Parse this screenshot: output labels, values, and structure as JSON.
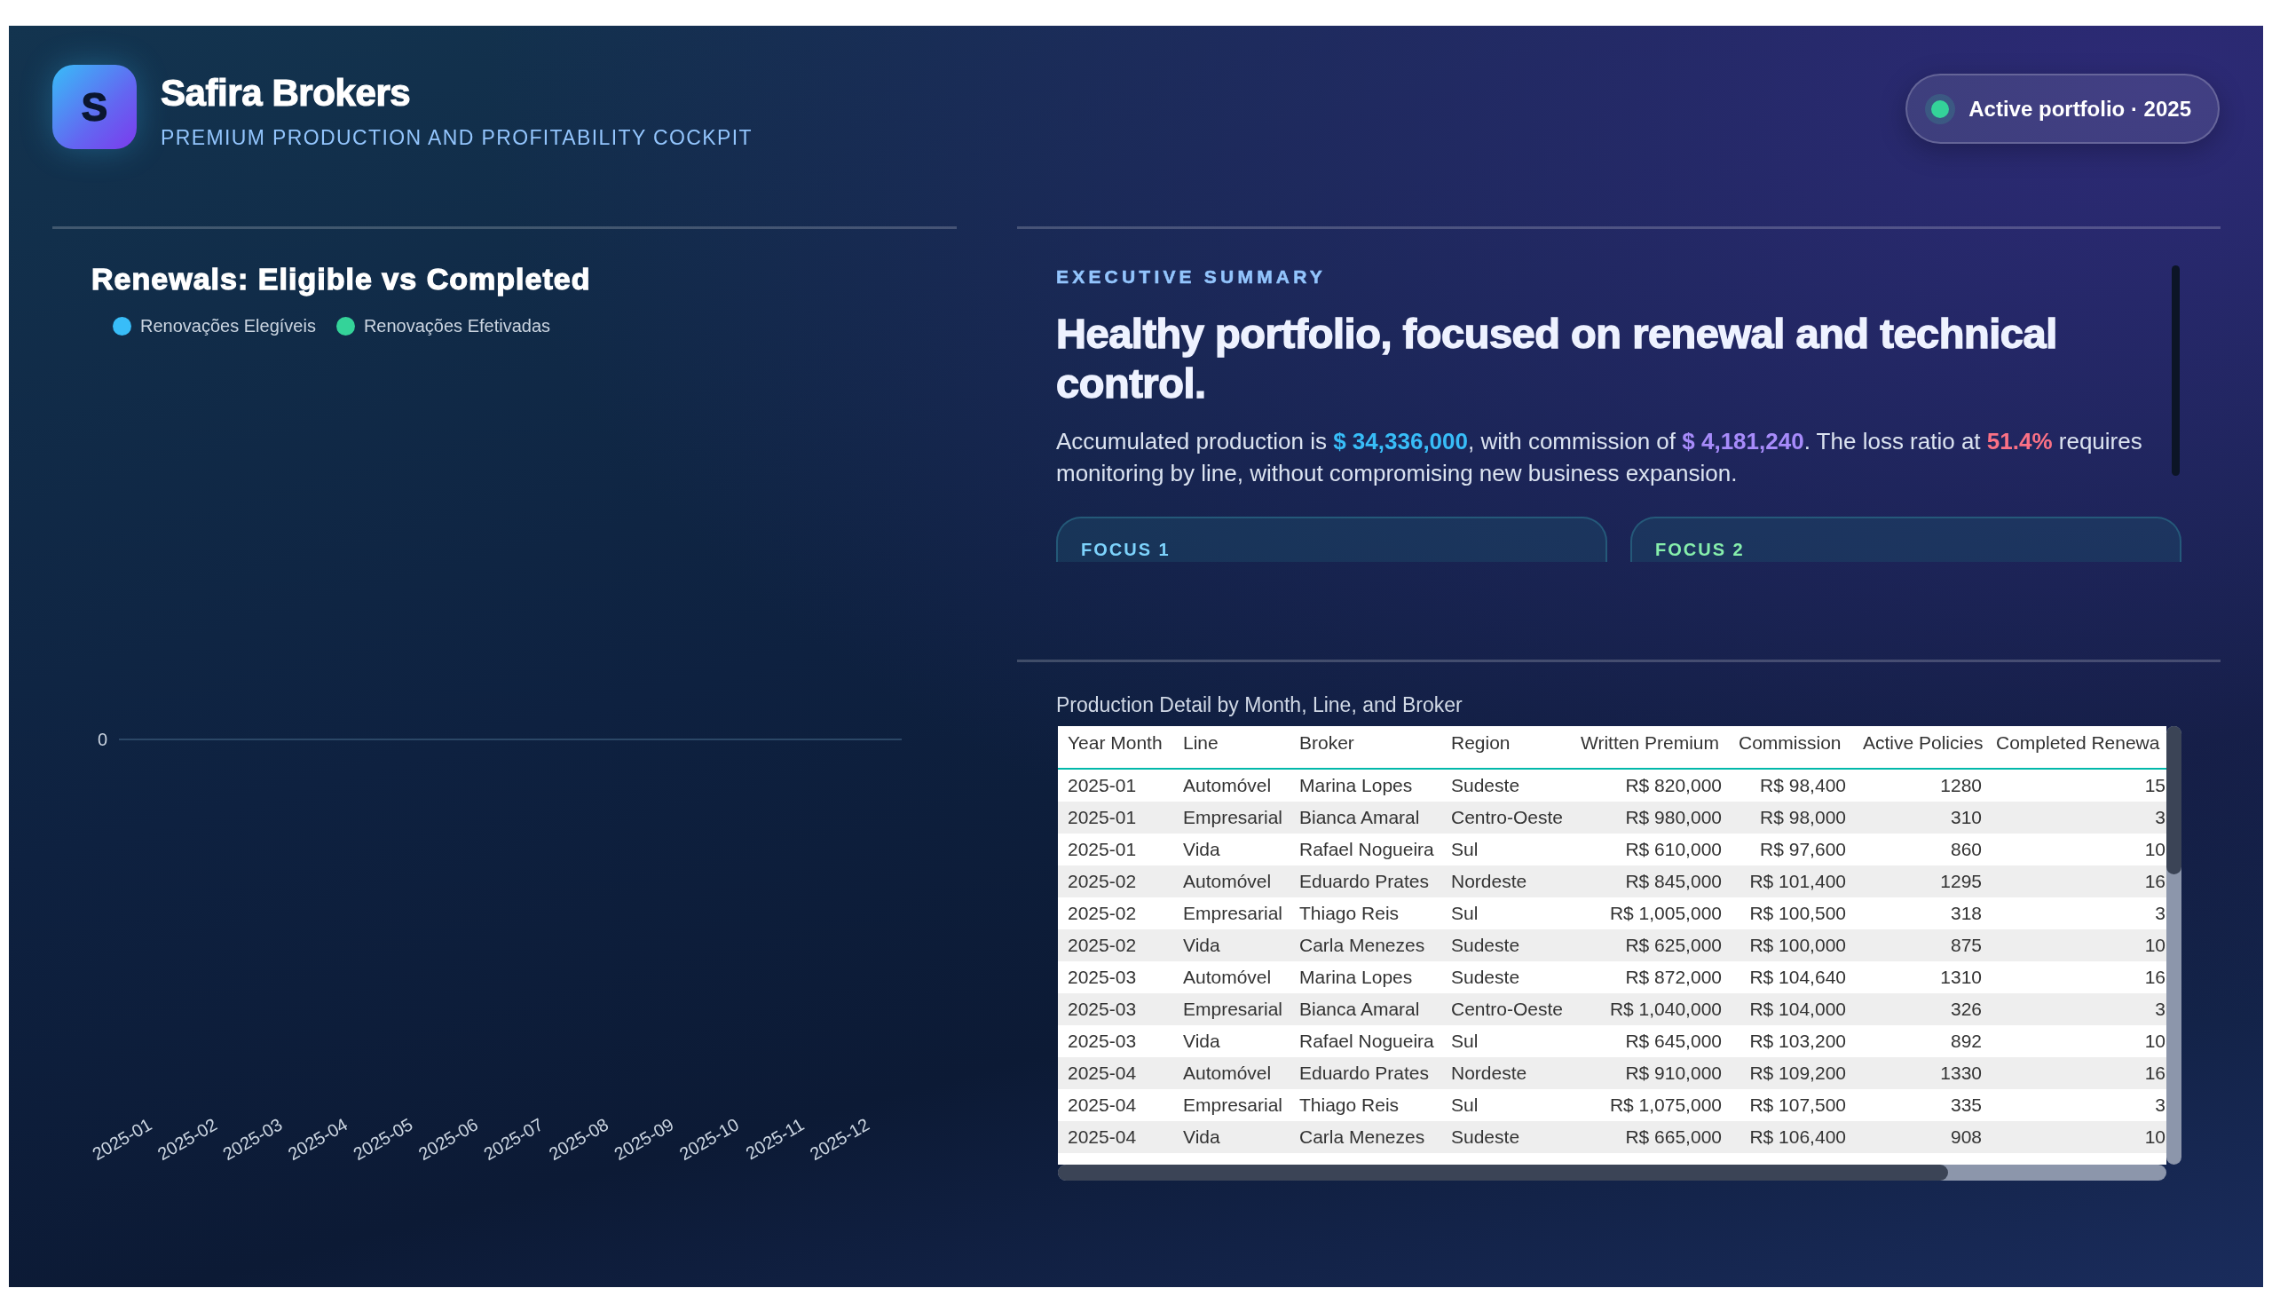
{
  "header": {
    "logo_letter": "S",
    "title": "Safira Brokers",
    "subtitle": "PREMIUM PRODUCTION AND PROFITABILITY COCKPIT",
    "status_badge": {
      "label": "Active portfolio · 2025"
    }
  },
  "renewals_chart": {
    "title": "Renewals: Eligible vs Completed",
    "legend": [
      {
        "label": "Renovações Elegíveis",
        "color": "#38bdf8"
      },
      {
        "label": "Renovações Efetivadas",
        "color": "#34d399"
      }
    ],
    "y_tick_labels": [
      "0"
    ],
    "x_labels": [
      "2025-01",
      "2025-02",
      "2025-03",
      "2025-04",
      "2025-05",
      "2025-06",
      "2025-07",
      "2025-08",
      "2025-09",
      "2025-10",
      "2025-11",
      "2025-12"
    ]
  },
  "executive_summary": {
    "eyebrow": "EXECUTIVE SUMMARY",
    "headline": "Healthy portfolio, focused on renewal and technical control.",
    "text": "Accumulated production is **$ 34,336,000**, with commission of **$ 4,181,240**. The loss ratio at **51.4%** requires monitoring by line, without compromising new business expansion.",
    "focus_cards": [
      {
        "label": "FOCUS 1",
        "color": "#7dd3fc"
      },
      {
        "label": "FOCUS 2",
        "color": "#86efac"
      }
    ]
  },
  "production_table": {
    "title": "Production Detail by Month, Line, and Broker",
    "columns": [
      {
        "label": "Year Month",
        "kind": "text"
      },
      {
        "label": "Line",
        "kind": "text"
      },
      {
        "label": "Broker",
        "kind": "text"
      },
      {
        "label": "Region",
        "kind": "text"
      },
      {
        "label": "Written Premium",
        "kind": "number"
      },
      {
        "label": "Commission",
        "kind": "number"
      },
      {
        "label": "Active Policies",
        "kind": "number"
      },
      {
        "label": "Completed Renewa",
        "kind": "number"
      }
    ],
    "rows": [
      [
        "2025-01",
        "Automóvel",
        "Marina Lopes",
        "Sudeste",
        "R$ 820,000",
        "R$ 98,400",
        "1280",
        "15"
      ],
      [
        "2025-01",
        "Empresarial",
        "Bianca Amaral",
        "Centro-Oeste",
        "R$ 980,000",
        "R$ 98,000",
        "310",
        "3"
      ],
      [
        "2025-01",
        "Vida",
        "Rafael Nogueira",
        "Sul",
        "R$ 610,000",
        "R$ 97,600",
        "860",
        "10"
      ],
      [
        "2025-02",
        "Automóvel",
        "Eduardo Prates",
        "Nordeste",
        "R$ 845,000",
        "R$ 101,400",
        "1295",
        "16"
      ],
      [
        "2025-02",
        "Empresarial",
        "Thiago Reis",
        "Sul",
        "R$ 1,005,000",
        "R$ 100,500",
        "318",
        "3"
      ],
      [
        "2025-02",
        "Vida",
        "Carla Menezes",
        "Sudeste",
        "R$ 625,000",
        "R$ 100,000",
        "875",
        "10"
      ],
      [
        "2025-03",
        "Automóvel",
        "Marina Lopes",
        "Sudeste",
        "R$ 872,000",
        "R$ 104,640",
        "1310",
        "16"
      ],
      [
        "2025-03",
        "Empresarial",
        "Bianca Amaral",
        "Centro-Oeste",
        "R$ 1,040,000",
        "R$ 104,000",
        "326",
        "3"
      ],
      [
        "2025-03",
        "Vida",
        "Rafael Nogueira",
        "Sul",
        "R$ 645,000",
        "R$ 103,200",
        "892",
        "10"
      ],
      [
        "2025-04",
        "Automóvel",
        "Eduardo Prates",
        "Nordeste",
        "R$ 910,000",
        "R$ 109,200",
        "1330",
        "16"
      ],
      [
        "2025-04",
        "Empresarial",
        "Thiago Reis",
        "Sul",
        "R$ 1,075,000",
        "R$ 107,500",
        "335",
        "3"
      ],
      [
        "2025-04",
        "Vida",
        "Carla Menezes",
        "Sudeste",
        "R$ 665,000",
        "R$ 106,400",
        "908",
        "10"
      ]
    ]
  }
}
